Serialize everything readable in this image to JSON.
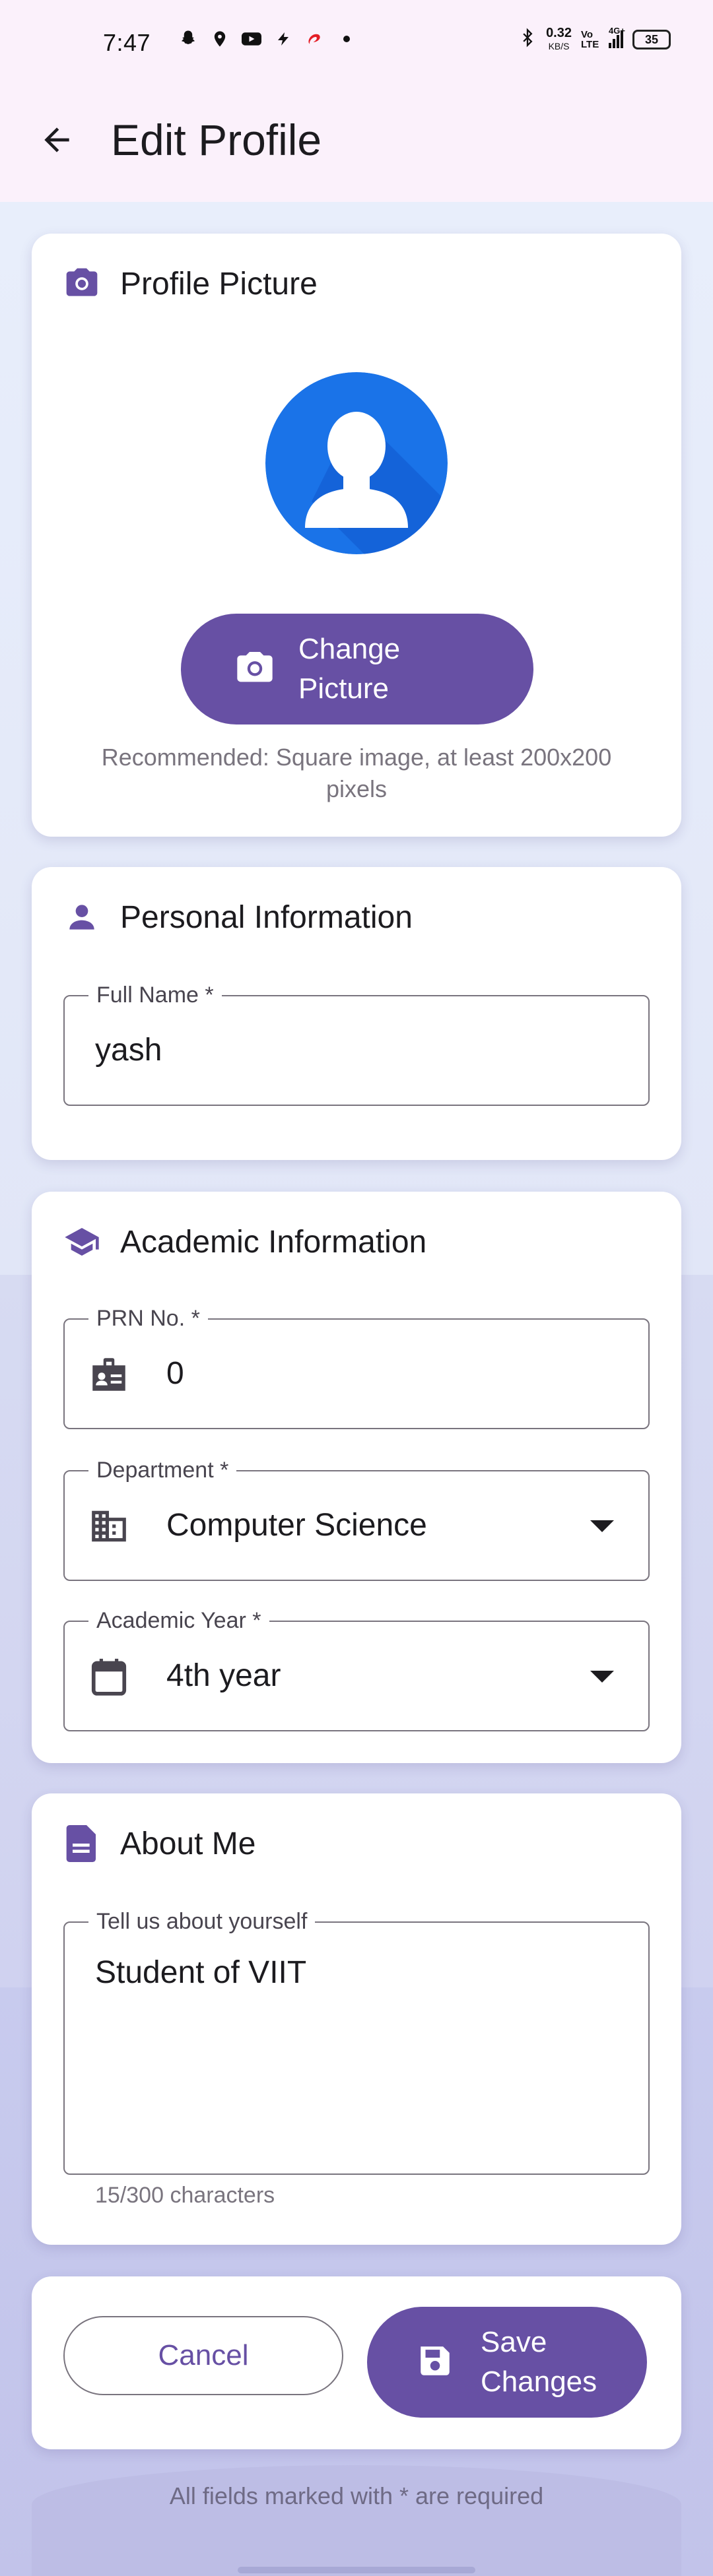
{
  "status_bar": {
    "time": "7:47",
    "speed_value": "0.32",
    "speed_unit": "KB/S",
    "network": "4G+",
    "volte": "Vo LTE",
    "battery": "35"
  },
  "app_bar": {
    "title": "Edit Profile",
    "back_icon": "arrow-back-icon"
  },
  "profile_picture": {
    "title": "Profile Picture",
    "icon": "camera-icon",
    "change_button": "Change Picture",
    "hint": "Recommended: Square image, at least 200x200 pixels"
  },
  "personal_info": {
    "title": "Personal Information",
    "icon": "person-icon",
    "full_name": {
      "label": "Full Name *",
      "value": "yash"
    }
  },
  "academic_info": {
    "title": "Academic Information",
    "icon": "school-icon",
    "prn": {
      "label": "PRN No. *",
      "value": "0",
      "icon": "badge-icon"
    },
    "department": {
      "label": "Department *",
      "value": "Computer Science",
      "icon": "building-icon"
    },
    "academic_year": {
      "label": "Academic Year *",
      "value": "4th year",
      "icon": "calendar-icon"
    }
  },
  "about_me": {
    "title": "About Me",
    "icon": "document-icon",
    "bio": {
      "label": "Tell us about yourself",
      "value": "Student of VIIT"
    },
    "counter": "15/300 characters"
  },
  "actions": {
    "cancel": "Cancel",
    "save": "Save Changes"
  },
  "footer_note": "All fields marked with * are required",
  "colors": {
    "primary": "#6750a4",
    "avatar_bg": "#1a73e8",
    "status_bar_bg": "#fbf1fb"
  }
}
